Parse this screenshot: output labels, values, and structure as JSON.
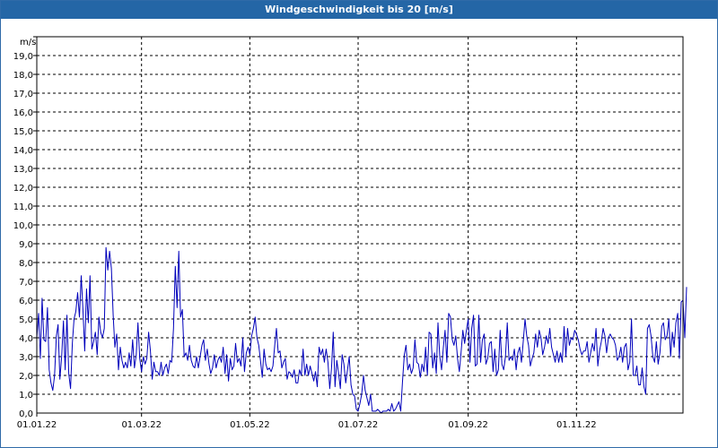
{
  "window": {
    "title": "Windgeschwindigkeit bis 20 [m/s]"
  },
  "colors": {
    "titlebar": "#2466a6",
    "series": "#0000bb",
    "grid": "#000000"
  },
  "chart_data": {
    "type": "line",
    "title": "Windgeschwindigkeit bis 20 [m/s]",
    "ylabel": "m/s",
    "xlabel": "",
    "ylim": [
      0,
      20
    ],
    "xlim": [
      "2022-01-01",
      "2022-12-31"
    ],
    "grid": true,
    "yticks": [
      "1,0",
      "2,0",
      "3,0",
      "4,0",
      "5,0",
      "6,0",
      "7,0",
      "8,0",
      "9,0",
      "10,0",
      "11,0",
      "12,0",
      "13,0",
      "14,0",
      "15,0",
      "16,0",
      "17,0",
      "18,0",
      "19,0"
    ],
    "y_origin_label": "0,0",
    "xticks": [
      {
        "date": "2022-01-01",
        "label": "01.01.22"
      },
      {
        "date": "2022-03-01",
        "label": "01.03.22"
      },
      {
        "date": "2022-05-01",
        "label": "01.05.22"
      },
      {
        "date": "2022-07-01",
        "label": "01.07.22"
      },
      {
        "date": "2022-09-01",
        "label": "01.09.22"
      },
      {
        "date": "2022-11-01",
        "label": "01.11.22"
      }
    ],
    "series": [
      {
        "name": "",
        "x_start": "2022-01-01",
        "x_step_days": 1,
        "values": [
          4.0,
          5.3,
          2.9,
          6.1,
          3.9,
          3.8,
          5.6,
          2.3,
          1.6,
          1.2,
          2.0,
          4.1,
          4.7,
          1.8,
          3.0,
          4.9,
          2.3,
          5.2,
          2.1,
          1.3,
          3.7,
          5.0,
          5.4,
          6.4,
          5.1,
          7.3,
          5.5,
          3.3,
          6.6,
          4.8,
          7.3,
          3.4,
          3.8,
          4.3,
          3.1,
          5.1,
          4.3,
          4.0,
          4.5,
          8.8,
          7.6,
          8.6,
          7.7,
          5.2,
          3.5,
          4.2,
          2.3,
          3.5,
          2.8,
          2.4,
          2.7,
          2.4,
          3.2,
          2.5,
          3.9,
          2.4,
          3.1,
          4.8,
          2.9,
          2.2,
          3.0,
          2.6,
          2.9,
          4.3,
          3.3,
          1.8,
          2.7,
          2.2,
          2.2,
          2.0,
          2.7,
          2.0,
          2.4,
          2.6,
          2.1,
          2.8,
          2.7,
          4.5,
          7.8,
          5.6,
          8.6,
          5.1,
          5.5,
          3.0,
          3.2,
          2.8,
          3.6,
          2.8,
          2.5,
          2.4,
          3.0,
          2.4,
          3.0,
          3.6,
          3.9,
          2.8,
          3.4,
          2.6,
          2.1,
          2.4,
          3.1,
          2.4,
          2.8,
          3.0,
          2.7,
          3.5,
          2.1,
          3.1,
          1.7,
          2.9,
          2.3,
          2.5,
          3.7,
          2.7,
          2.9,
          2.5,
          4.0,
          2.2,
          3.2,
          3.5,
          3.1,
          4.1,
          4.5,
          5.1,
          4.0,
          3.6,
          2.8,
          1.9,
          3.4,
          2.6,
          2.3,
          2.4,
          2.2,
          2.5,
          3.6,
          4.5,
          3.2,
          3.3,
          2.4,
          2.7,
          2.9,
          1.8,
          2.2,
          2.1,
          1.9,
          2.3,
          1.6,
          1.6,
          2.3,
          2.0,
          3.4,
          2.0,
          2.6,
          2.0,
          2.5,
          2.1,
          1.7,
          2.2,
          1.4,
          3.5,
          3.1,
          3.4,
          2.7,
          3.4,
          2.7,
          1.3,
          2.4,
          4.3,
          1.4,
          2.8,
          2.1,
          1.3,
          3.1,
          2.6,
          1.6,
          2.3,
          3.0,
          1.5,
          1.0,
          0.9,
          0.2,
          0.1,
          0.5,
          1.0,
          2.0,
          1.2,
          0.8,
          0.4,
          1.0,
          0.1,
          0.1,
          0.1,
          0.2,
          0.1,
          0.0,
          0.1,
          0.1,
          0.1,
          0.2,
          0.1,
          0.5,
          0.1,
          0.2,
          0.4,
          0.6,
          0.1,
          1.7,
          3.1,
          3.6,
          2.3,
          2.6,
          2.1,
          2.4,
          3.9,
          2.7,
          2.6,
          1.9,
          2.6,
          2.2,
          3.5,
          2.0,
          4.3,
          4.2,
          2.4,
          3.2,
          2.1,
          4.8,
          3.0,
          2.3,
          3.5,
          4.4,
          2.7,
          5.3,
          5.1,
          3.9,
          3.6,
          4.1,
          2.9,
          2.2,
          3.2,
          4.4,
          3.7,
          4.4,
          5.0,
          2.7,
          4.5,
          5.2,
          2.5,
          2.6,
          5.2,
          2.7,
          3.9,
          4.2,
          2.6,
          2.9,
          3.7,
          3.8,
          2.2,
          3.4,
          2.0,
          2.3,
          4.4,
          2.6,
          2.3,
          3.0,
          4.8,
          2.8,
          3.0,
          2.8,
          3.4,
          2.3,
          3.2,
          3.5,
          2.7,
          3.8,
          5.0,
          4.1,
          3.6,
          2.5,
          2.9,
          3.2,
          4.2,
          3.5,
          4.4,
          4.0,
          3.1,
          3.5,
          4.1,
          3.7,
          4.5,
          3.5,
          3.1,
          2.7,
          3.3,
          2.7,
          3.2,
          2.7,
          4.6,
          3.0,
          4.5,
          3.6,
          4.0,
          3.9,
          4.4,
          4.2,
          3.9,
          3.4,
          3.1,
          3.3,
          3.3,
          3.8,
          2.7,
          3.2,
          3.7,
          3.3,
          4.5,
          2.5,
          3.3,
          3.8,
          4.5,
          4.1,
          3.2,
          4.0,
          4.2,
          4.0,
          3.9,
          3.6,
          2.8,
          3.0,
          3.5,
          2.7,
          3.5,
          3.7,
          2.3,
          2.7,
          5.0,
          2.0,
          2.0,
          2.5,
          1.5,
          1.5,
          2.4,
          1.4,
          1.0,
          4.5,
          4.7,
          4.1,
          3.0,
          2.7,
          3.8,
          2.6,
          3.2,
          4.6,
          4.8,
          3.9,
          4.1,
          5.0,
          3.0,
          4.3,
          3.5,
          4.8,
          5.3,
          2.9,
          5.9,
          6.0,
          4.0,
          6.7
        ]
      }
    ]
  }
}
